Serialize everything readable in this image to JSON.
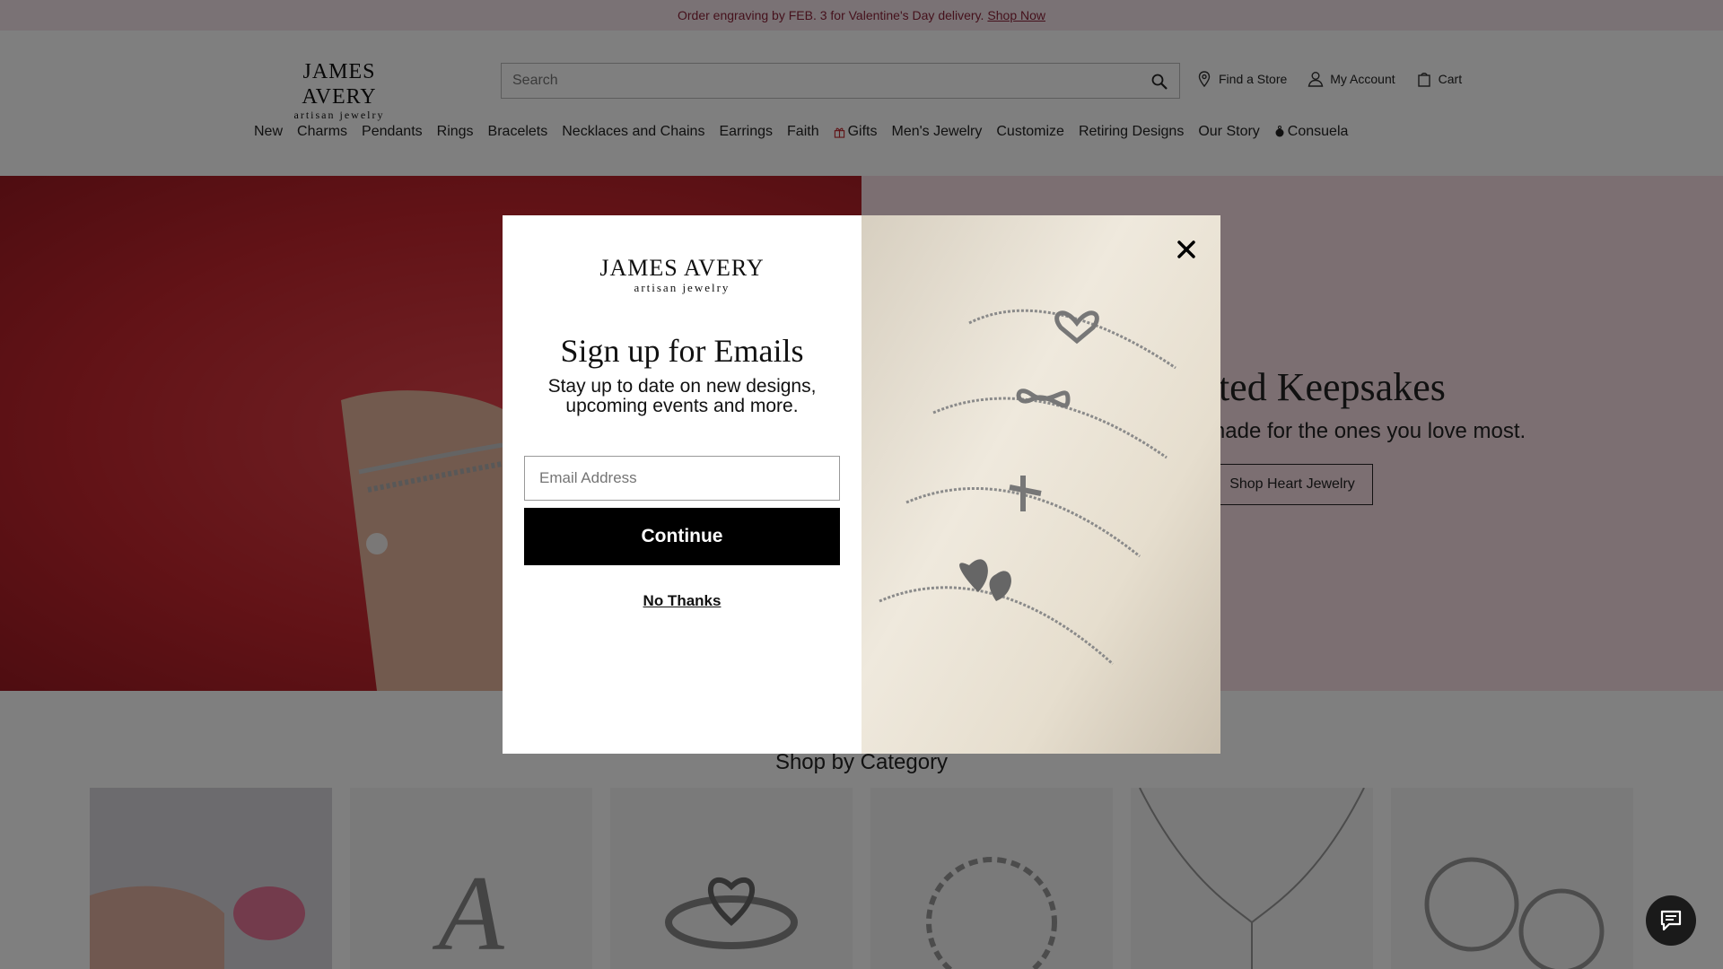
{
  "promo": {
    "text": "Order engraving by FEB. 3 for Valentine's Day delivery.",
    "link": "Shop Now"
  },
  "header": {
    "logo_line1": "JAMES AVERY",
    "logo_line2": "artisan jewelry",
    "search_placeholder": "Search",
    "find_store": "Find a Store",
    "my_account": "My Account",
    "cart": "Cart",
    "nav": [
      "New",
      "Charms",
      "Pendants",
      "Rings",
      "Bracelets",
      "Necklaces and Chains",
      "Earrings",
      "Faith",
      "Gifts",
      "Men's Jewelry",
      "Customize",
      "Retiring Designs",
      "Our Story",
      "Consuela"
    ]
  },
  "hero": {
    "title": "rafted Keepsakes",
    "subtitle": "eaning and made for the ones you love most.",
    "button": "Shop Heart Jewelry"
  },
  "category": {
    "title": "Shop by Category"
  },
  "modal": {
    "logo_line1": "JAMES AVERY",
    "logo_line2": "artisan jewelry",
    "title": "Sign up for Emails",
    "subtitle": "Stay up to date on new designs, upcoming events and more.",
    "email_placeholder": "Email Address",
    "continue": "Continue",
    "no_thanks": "No Thanks"
  },
  "colors": {
    "promo_bg": "#f5e4ea",
    "promo_text": "#8a2339",
    "hero_bg": "#f8dfe5",
    "overlay": "rgba(0,0,0,0.5)",
    "button_dark": "#000000"
  }
}
